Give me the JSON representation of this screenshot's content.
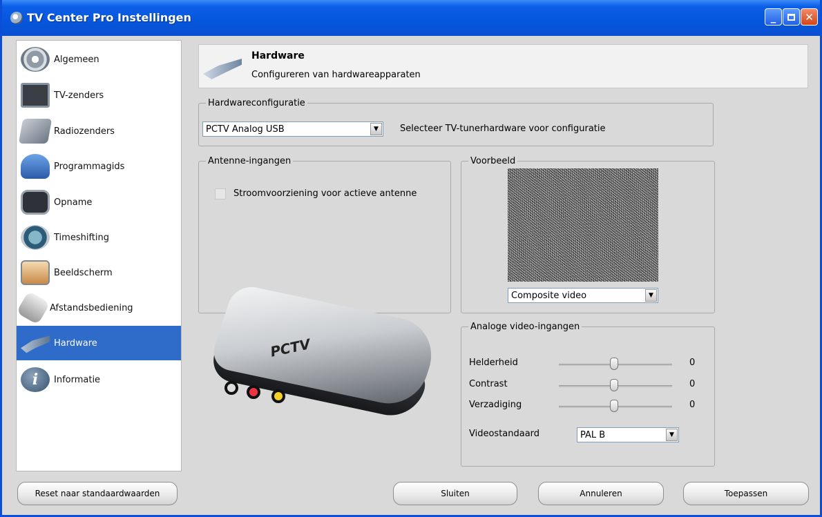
{
  "window": {
    "title": "TV Center Pro Instellingen"
  },
  "sidebar": {
    "items": [
      {
        "label": "Algemeen",
        "icon": "settings-icon"
      },
      {
        "label": "TV-zenders",
        "icon": "tv-icon"
      },
      {
        "label": "Radiozenders",
        "icon": "radio-icon"
      },
      {
        "label": "Programmagids",
        "icon": "program-guide-icon"
      },
      {
        "label": "Opname",
        "icon": "recording-icon"
      },
      {
        "label": "Timeshifting",
        "icon": "timeshifting-icon"
      },
      {
        "label": "Beeldscherm",
        "icon": "display-icon"
      },
      {
        "label": "Afstandsbediening",
        "icon": "remote-control-icon"
      },
      {
        "label": "Hardware",
        "icon": "hardware-icon",
        "active": true
      },
      {
        "label": "Informatie",
        "icon": "info-icon"
      }
    ]
  },
  "header": {
    "title": "Hardware",
    "subtitle": "Configureren van hardwareapparaten"
  },
  "hw_config": {
    "legend": "Hardwareconfiguratie",
    "device_value": "PCTV Analog USB",
    "hint": "Selecteer TV-tunerhardware voor configuratie"
  },
  "antenna": {
    "legend": "Antenne-ingangen",
    "power_label": "Stroomvoorziening voor actieve antenne",
    "power_checked": false
  },
  "preview": {
    "legend": "Voorbeeld",
    "source_value": "Composite video"
  },
  "analog": {
    "legend": "Analoge video-ingangen",
    "sliders": [
      {
        "label": "Helderheid",
        "value": "0"
      },
      {
        "label": "Contrast",
        "value": "0"
      },
      {
        "label": "Verzadiging",
        "value": "0"
      }
    ],
    "standard_label": "Videostandaard",
    "standard_value": "PAL B"
  },
  "device": {
    "brand_text": "PCTV"
  },
  "buttons": {
    "reset": "Reset naar standaardwaarden",
    "close": "Sluiten",
    "cancel": "Annuleren",
    "apply": "Toepassen"
  },
  "colors": {
    "titlebar": "#0556dd",
    "selection": "#2f6bc9"
  }
}
